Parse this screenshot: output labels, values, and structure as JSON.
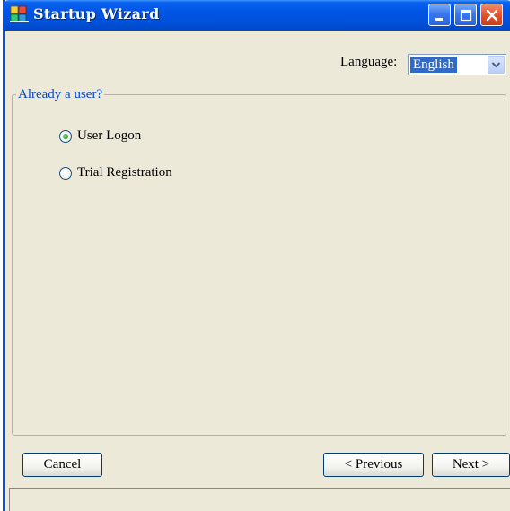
{
  "window": {
    "title": "Startup Wizard",
    "app_icon": "wizard-app-icon"
  },
  "title_buttons": {
    "minimize_icon": "minimize-icon",
    "maximize_icon": "maximize-icon",
    "close_icon": "close-icon"
  },
  "language": {
    "label": "Language:",
    "selected": "English"
  },
  "group": {
    "legend": "Already a user?",
    "options": [
      {
        "label": "User Logon",
        "checked": true
      },
      {
        "label": "Trial Registration",
        "checked": false
      }
    ]
  },
  "buttons": {
    "cancel": "Cancel",
    "previous": "< Previous",
    "next": "Next >"
  },
  "colors": {
    "titlebar": "#0054e3",
    "legend_text": "#0046d5",
    "selection": "#316ac5",
    "close_button": "#e0532b"
  }
}
